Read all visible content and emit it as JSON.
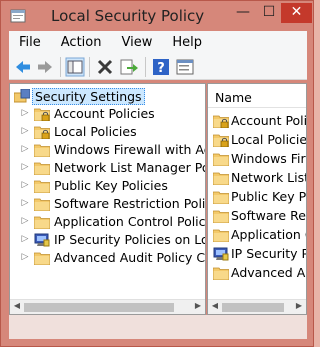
{
  "window": {
    "title": "Local Security Policy",
    "controls": {
      "minimize": "—",
      "maximize": "☐",
      "close": "✕"
    }
  },
  "menu": [
    "File",
    "Action",
    "View",
    "Help"
  ],
  "toolbar": {
    "buttons": [
      "back-icon",
      "forward-icon",
      "show-hide-tree-icon",
      "delete-icon",
      "export-list-icon",
      "help-icon",
      "properties-icon"
    ]
  },
  "tree": {
    "root": "Security Settings",
    "items": [
      {
        "label": "Account Policies",
        "icon": "folder-lock-icon"
      },
      {
        "label": "Local Policies",
        "icon": "folder-lock-icon"
      },
      {
        "label": "Windows Firewall with Adva",
        "icon": "folder-icon"
      },
      {
        "label": "Network List Manager Polici",
        "icon": "folder-icon"
      },
      {
        "label": "Public Key Policies",
        "icon": "folder-icon"
      },
      {
        "label": "Software Restriction Policies",
        "icon": "folder-icon"
      },
      {
        "label": "Application Control Policies",
        "icon": "folder-icon"
      },
      {
        "label": "IP Security Policies on Local",
        "icon": "ip-security-icon"
      },
      {
        "label": "Advanced Audit Policy Conf",
        "icon": "folder-icon"
      }
    ]
  },
  "list": {
    "column": "Name",
    "items": [
      {
        "label": "Account Polic",
        "icon": "folder-lock-icon"
      },
      {
        "label": "Local Policies",
        "icon": "folder-lock-icon"
      },
      {
        "label": "Windows Firew",
        "icon": "folder-icon"
      },
      {
        "label": "Network List M",
        "icon": "folder-icon"
      },
      {
        "label": "Public Key Pol",
        "icon": "folder-icon"
      },
      {
        "label": "Software Restr",
        "icon": "folder-icon"
      },
      {
        "label": "Application Co",
        "icon": "folder-icon"
      },
      {
        "label": "IP Security Pol",
        "icon": "ip-security-icon"
      },
      {
        "label": "Advanced Aud",
        "icon": "folder-icon"
      }
    ]
  },
  "colors": {
    "frame": "#d6877a",
    "close": "#c4392b",
    "selection": "#cce8ff",
    "folder": "#f3c96a"
  }
}
